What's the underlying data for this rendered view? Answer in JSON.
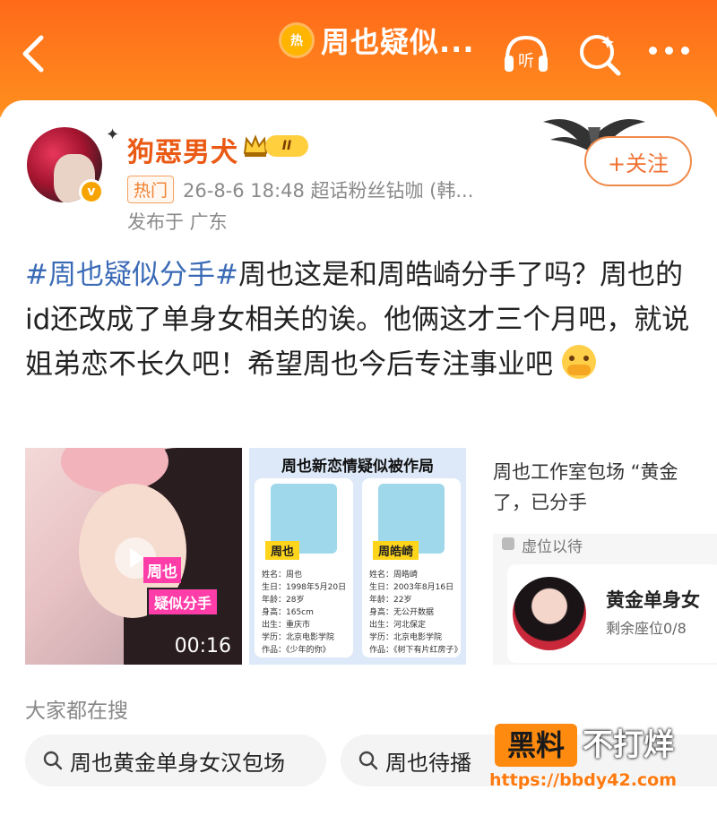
{
  "header": {
    "title": "周也疑似...",
    "hot_badge": "热",
    "icons": [
      "back-icon",
      "listen-icon",
      "search-icon",
      "more-icon"
    ]
  },
  "post": {
    "author": "狗惡男犬",
    "level": "II",
    "verified_badge": "v",
    "tag": "热门",
    "meta": "26-8-6 18:48  超话粉丝钻咖 (韩...",
    "location": "发布于 广东",
    "follow_label": "+关注",
    "topic": "#周也疑似分手#",
    "text": "周也这是和周皓崎分手了吗？周也的id还改成了单身女相关的诶。他俩这才三个月吧，就说姐弟恋不长久吧！希望周也今后专注事业吧"
  },
  "images": {
    "video": {
      "caption_a": "周也",
      "caption_b": "疑似分手",
      "duration": "00:16"
    },
    "infographic": {
      "heading": "周也新恋情疑似被作局",
      "left": {
        "name_tag": "周也",
        "lines": [
          "姓名：周也",
          "生日：1998年5月20日",
          "年龄：28岁",
          "身高：165cm",
          "出生：重庆市",
          "学历：北京电影学院",
          "作品：《少年的你》"
        ]
      },
      "right": {
        "name_tag": "周皓崎",
        "lines": [
          "姓名：周皓崎",
          "生日：2003年8月16日",
          "年龄：22岁",
          "身高：无公开数据",
          "出生：河北保定",
          "学历：北京电影学院",
          "作品：《树下有片红房子》"
        ]
      }
    },
    "third": {
      "text": "周也工作室包场 “黄金 了，已分手",
      "hold": "虚位以待",
      "title": "黄金单身女",
      "sub": "剩余座位0/8"
    }
  },
  "search": {
    "label": "大家都在搜",
    "chips": [
      "周也黄金单身女汉包场",
      "周也待播"
    ]
  },
  "watermark": {
    "block": "黑料",
    "text": "不打烊",
    "url": "https://bbdy42.com"
  },
  "colors": {
    "brand_orange": "#ff7a1c",
    "username": "#ea5a15",
    "topic": "#3a6ab6"
  }
}
